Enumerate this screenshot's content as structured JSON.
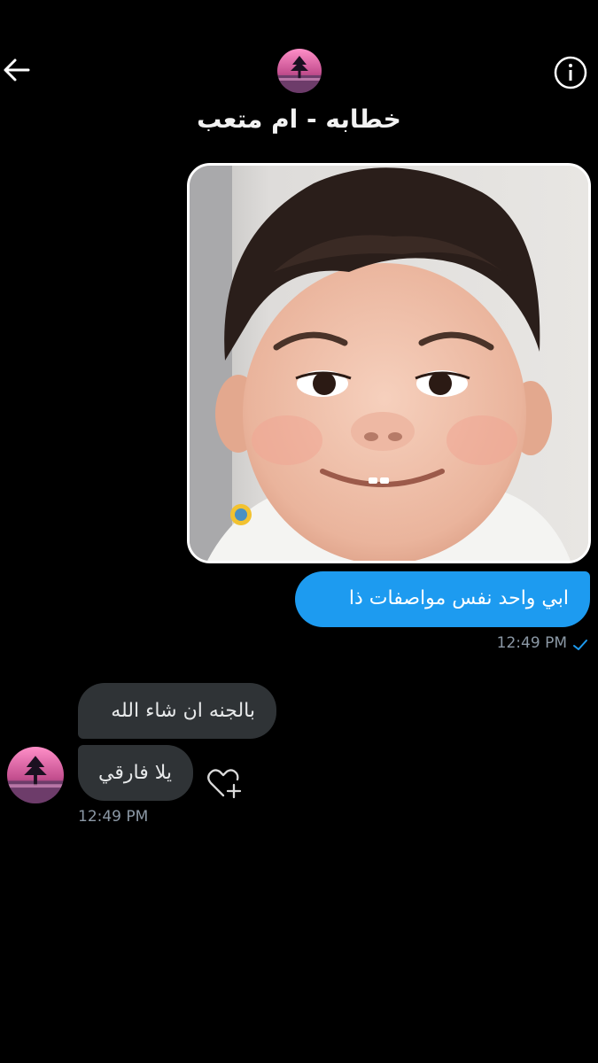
{
  "header": {
    "back_icon": "arrow-left-icon",
    "info_icon": "info-circle-icon",
    "contact_name": "خطابه - ام متعب",
    "avatar": "sunset-tree-avatar"
  },
  "messages": {
    "media": {
      "description_icon": "baby-photo"
    },
    "outgoing": {
      "text": "ابي واحد نفس مواصفات ذا",
      "time": "12:49 PM",
      "status_icon": "checkmark-icon"
    },
    "incoming": [
      {
        "text": "بالجنه ان شاء الله"
      },
      {
        "text": "يلا فارقي"
      }
    ],
    "incoming_time": "12:49 PM",
    "react_icon": "heart-plus-icon"
  },
  "colors": {
    "background": "#000000",
    "outgoing_bubble": "#1d9bf0",
    "incoming_bubble": "#2f3336",
    "timestamp": "#8b98a5"
  }
}
